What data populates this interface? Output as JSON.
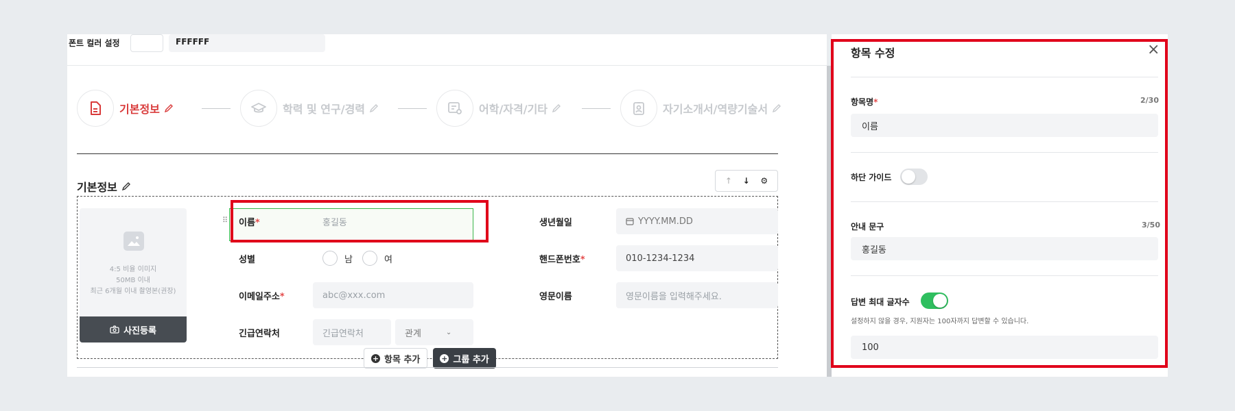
{
  "font_color": {
    "label": "폰트 컬러 설정",
    "value": "FFFFFF"
  },
  "steps": [
    {
      "label": "기본정보",
      "active": true
    },
    {
      "label": "학력 및 연구/경력",
      "active": false
    },
    {
      "label": "어학/자격/기타",
      "active": false
    },
    {
      "label": "자기소개서/역량기술서",
      "active": false
    }
  ],
  "section": {
    "title": "기본정보",
    "up": "↑",
    "down": "↓",
    "settings": "⚙"
  },
  "photo": {
    "hint_1": "4:5 비율 이미지",
    "hint_2": "50MB 이내",
    "hint_3": "최근 6개월 이내 촬영본(권장)",
    "button": "사진등록"
  },
  "form": {
    "name": {
      "label": "이름",
      "required": "*",
      "placeholder": "홍길동"
    },
    "birth": {
      "label": "생년월일",
      "placeholder": "YYYY.MM.DD"
    },
    "gender": {
      "label": "성별",
      "male": "남",
      "female": "여"
    },
    "phone": {
      "label": "핸드폰번호",
      "required": "*",
      "placeholder": "010-1234-1234"
    },
    "email": {
      "label": "이메일주소",
      "required": "*",
      "placeholder": "abc@xxx.com"
    },
    "eng_name": {
      "label": "영문이름",
      "placeholder": "영문이름을 입력해주세요."
    },
    "emergency": {
      "label": "긴급연락처",
      "placeholder": "긴급연락처",
      "relation": "관계"
    }
  },
  "actions": {
    "add_item": "항목 추가",
    "add_group": "그룹 추가"
  },
  "side_panel": {
    "title": "항목 수정",
    "close": "×",
    "item_name": {
      "label": "항목명",
      "required": "*",
      "count": "2/30",
      "value": "이름"
    },
    "guide": {
      "label": "하단 가이드",
      "enabled": false
    },
    "hint_text": {
      "label": "안내 문구",
      "count": "3/50",
      "value": "홍길동"
    },
    "max_chars": {
      "label": "답변 최대 글자수",
      "enabled": true,
      "note": "설정하지 않을 경우, 지원자는 100자까지 답변할 수 있습니다.",
      "value": "100"
    }
  },
  "colors": {
    "accent": "#d93a3a",
    "toggle_on": "#2fbf5f",
    "highlight": "#e0001a",
    "dark_button": "#474c52"
  }
}
